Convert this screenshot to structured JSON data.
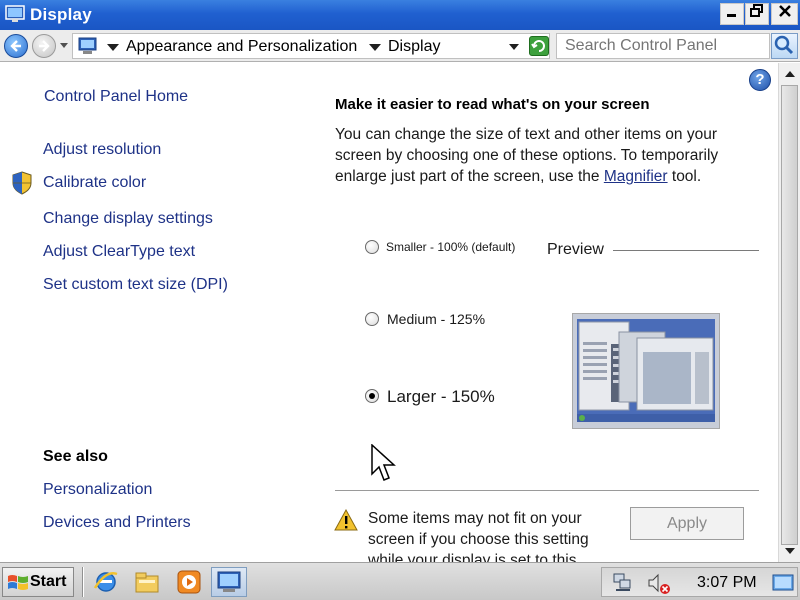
{
  "window": {
    "title": "Display"
  },
  "address_bar": {
    "breadcrumbs": [
      "Appearance and Personalization",
      "Display"
    ],
    "search_placeholder": "Search Control Panel"
  },
  "sidebar": {
    "home_link": "Control Panel Home",
    "tasks": [
      "Adjust resolution",
      "Calibrate color",
      "Change display settings",
      "Adjust ClearType text",
      "Set custom text size (DPI)"
    ],
    "see_also_heading": "See also",
    "see_also": [
      "Personalization",
      "Devices and Printers"
    ]
  },
  "main": {
    "heading": "Make it easier to read what's on your screen",
    "intro_before": "You can change the size of text and other items on your screen by choosing one of these options. To temporarily enlarge just part of the screen, use the ",
    "intro_link": "Magnifier",
    "intro_after": " tool.",
    "options": [
      {
        "label": "Smaller - 100% (default)",
        "selected": false
      },
      {
        "label": "Medium - 125%",
        "selected": false
      },
      {
        "label": "Larger - 150%",
        "selected": true
      }
    ],
    "preview_label": "Preview",
    "warning_text": "Some items may not fit on your screen if you choose this setting while your display is set to this resolution.",
    "apply_label": "Apply"
  },
  "taskbar": {
    "start_label": "Start",
    "clock": "3:07 PM"
  },
  "colors": {
    "titlebar": "#2060d0",
    "link": "#1e3287",
    "apply_disabled_text": "#8a8a8a"
  },
  "icons": [
    "display-app-icon",
    "back-arrow-icon",
    "forward-arrow-icon",
    "control-panel-icon",
    "refresh-icon",
    "search-icon",
    "help-icon",
    "uac-shield-icon",
    "mouse-cursor-icon",
    "warning-icon",
    "windows-logo-icon",
    "internet-explorer-icon",
    "folder-icon",
    "media-player-icon",
    "control-panel-taskbar-icon",
    "network-icon",
    "speaker-muted-icon",
    "show-desktop-icon"
  ]
}
